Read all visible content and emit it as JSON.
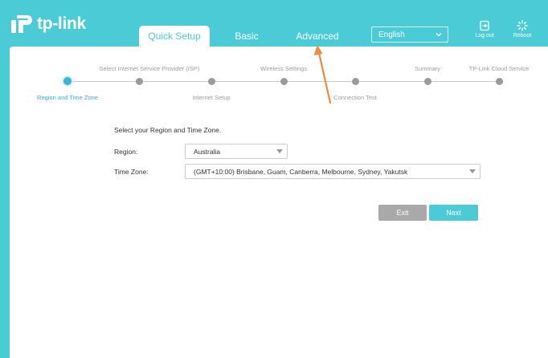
{
  "header": {
    "brand": "tp-link",
    "tabs": [
      {
        "label": "Quick Setup",
        "active": true
      },
      {
        "label": "Basic",
        "active": false
      },
      {
        "label": "Advanced",
        "active": false
      }
    ],
    "language": "English",
    "logout_label": "Log out",
    "reboot_label": "Reboot"
  },
  "stepper": {
    "steps": [
      {
        "label": "Region and Time Zone",
        "state": "active"
      },
      {
        "label": "Select Internet Service Provider (ISP)",
        "state": "pending"
      },
      {
        "label": "Internet Setup",
        "state": "pending"
      },
      {
        "label": "Wireless Settings",
        "state": "pending"
      },
      {
        "label": "Connection Test",
        "state": "pending"
      },
      {
        "label": "Summary",
        "state": "pending"
      },
      {
        "label": "TP-Link Cloud Service",
        "state": "pending"
      }
    ]
  },
  "form": {
    "title": "Select your Region and Time Zone.",
    "region_label": "Region:",
    "region_value": "Australia",
    "timezone_label": "Time Zone:",
    "timezone_value": "(GMT+10:00) Brisbane, Guam, Canberra, Melbourne, Sydney, Yakutsk"
  },
  "actions": {
    "exit_label": "Exit",
    "next_label": "Next"
  },
  "colors": {
    "brand_teal": "#4acbd6",
    "active_step": "#35b7d6",
    "exit_gray": "#a9a9a9",
    "annotation_arrow": "#f08a3c"
  },
  "icons": [
    "logout-icon",
    "reboot-icon",
    "chevron-down-icon"
  ]
}
